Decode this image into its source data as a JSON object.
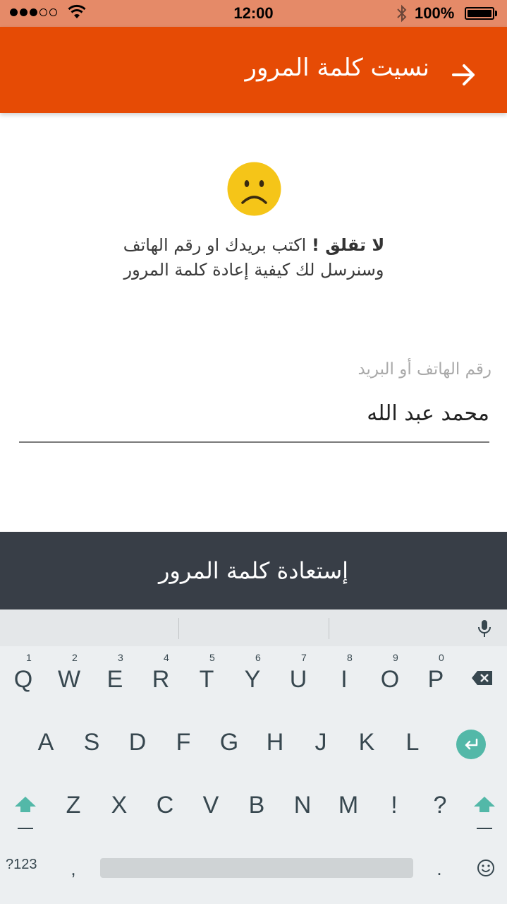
{
  "status_bar": {
    "time": "12:00",
    "battery": "100%"
  },
  "app_bar": {
    "title": "نسيت كلمة المرور",
    "back_icon": "arrow-right-icon"
  },
  "message": {
    "bold": "لا تقلق !",
    "line1": " اكتب بريدك او رقم الهاتف",
    "line2": "وسنرسل لك كيفية إعادة كلمة المرور"
  },
  "field": {
    "label": "رقم الهاتف أو البريد",
    "value": "محمد عبد الله"
  },
  "recover_button": "إستعادة كلمة المرور",
  "keyboard": {
    "row1": [
      "Q",
      "W",
      "E",
      "R",
      "T",
      "Y",
      "U",
      "I",
      "O",
      "P"
    ],
    "row1_nums": [
      "1",
      "2",
      "3",
      "4",
      "5",
      "6",
      "7",
      "8",
      "9",
      "0"
    ],
    "row2": [
      "A",
      "S",
      "D",
      "F",
      "G",
      "H",
      "J",
      "K",
      "L"
    ],
    "row3": [
      "Z",
      "X",
      "C",
      "V",
      "B",
      "N",
      "M",
      "!",
      "?"
    ],
    "mode_key": "?123",
    "comma": ",",
    "period": "."
  },
  "colors": {
    "status_bar": "#e58a68",
    "app_bar": "#e64b05",
    "button": "#383e47",
    "enter_key": "#53b8a8",
    "emoji_face": "#f5c518"
  }
}
